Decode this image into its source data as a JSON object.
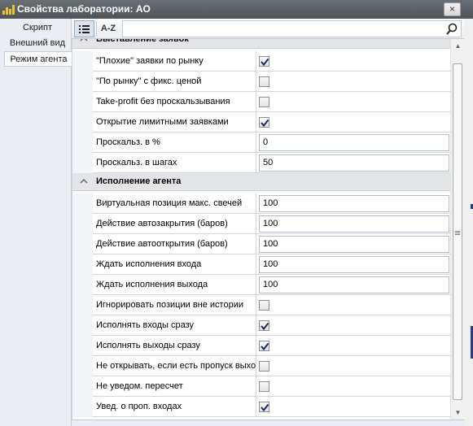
{
  "window": {
    "title": "Свойства лаборатории: AO",
    "close_label": "×",
    "app_icon": "chart-bars-icon"
  },
  "side_tabs": [
    {
      "label": "Скрипт",
      "active": false
    },
    {
      "label": "Внешний вид",
      "active": false
    },
    {
      "label": "Режим агента",
      "active": true
    }
  ],
  "toolbar": {
    "categorized_icon": "categorized-view-icon",
    "alpha_label": "A-Z",
    "search_value": "",
    "search_icon": "search-icon"
  },
  "grid": {
    "categories": [
      {
        "label": "Выставление заявок",
        "rows": [
          {
            "name": "\"Плохие\" заявки по рынку",
            "type": "checkbox",
            "checked": true
          },
          {
            "name": "\"По рынку\" с фикс. ценой",
            "type": "checkbox",
            "checked": false
          },
          {
            "name": "Take-profit без проскальзывания",
            "type": "checkbox",
            "checked": false
          },
          {
            "name": "Открытие лимитными заявками",
            "type": "checkbox",
            "checked": true
          },
          {
            "name": "Проскальз. в %",
            "type": "text",
            "value": "0"
          },
          {
            "name": "Проскальз. в шагах",
            "type": "text",
            "value": "50"
          }
        ]
      },
      {
        "label": "Исполнение агента",
        "rows": [
          {
            "name": "Виртуальная позиция макс. свечей",
            "type": "text",
            "value": "100"
          },
          {
            "name": "Действие автозакрытия (баров)",
            "type": "text",
            "value": "100"
          },
          {
            "name": "Действие автооткрытия (баров)",
            "type": "text",
            "value": "100"
          },
          {
            "name": "Ждать исполнения входа",
            "type": "text",
            "value": "100"
          },
          {
            "name": "Ждать исполнения выхода",
            "type": "text",
            "value": "100"
          },
          {
            "name": "Игнорировать позиции вне истории",
            "type": "checkbox",
            "checked": false
          },
          {
            "name": "Исполнять входы сразу",
            "type": "checkbox",
            "checked": true
          },
          {
            "name": "Исполнять выходы сразу",
            "type": "checkbox",
            "checked": true
          },
          {
            "name": "Не открывать, если есть пропуск выхода",
            "type": "checkbox",
            "checked": false
          },
          {
            "name": "Не уведом. пересчет",
            "type": "checkbox",
            "checked": false
          },
          {
            "name": "Увед. о проп. входах",
            "type": "checkbox",
            "checked": true
          }
        ]
      }
    ]
  },
  "colors": {
    "title_bar": "#565b60",
    "side_panel": "#eaeef4",
    "category_bg": "#e3e5e8",
    "check_mark": "#1c2a5e"
  }
}
